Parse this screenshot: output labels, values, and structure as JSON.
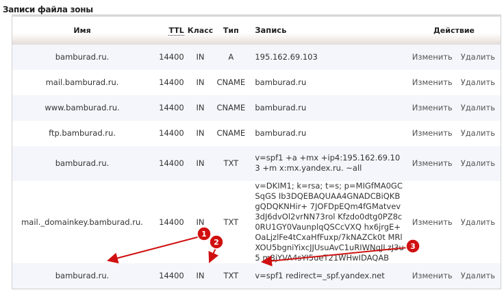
{
  "title": "Записи файла зоны",
  "headers": {
    "name": "Имя",
    "ttl": "TTL",
    "class": "Класс",
    "type": "Тип",
    "record": "Запись",
    "action": "Действие"
  },
  "actions": {
    "edit": "Изменить",
    "delete": "Удалить"
  },
  "rows": [
    {
      "name": "bamburad.ru.",
      "ttl": "14400",
      "class": "IN",
      "type": "A",
      "record": "195.162.69.103"
    },
    {
      "name": "mail.bamburad.ru.",
      "ttl": "14400",
      "class": "IN",
      "type": "CNAME",
      "record": "bamburad.ru"
    },
    {
      "name": "www.bamburad.ru.",
      "ttl": "14400",
      "class": "IN",
      "type": "CNAME",
      "record": "bamburad.ru"
    },
    {
      "name": "ftp.bamburad.ru.",
      "ttl": "14400",
      "class": "IN",
      "type": "CNAME",
      "record": "bamburad.ru"
    },
    {
      "name": "bamburad.ru.",
      "ttl": "14400",
      "class": "IN",
      "type": "TXT",
      "record": "v=spf1 +a +mx +ip4:195.162.69.103 +m x:mx.yandex.ru. ~all"
    },
    {
      "name": "mail._domainkey.bamburad.ru.",
      "ttl": "14400",
      "class": "IN",
      "type": "TXT",
      "record": "v=DKIM1; k=rsa; t=s; p=MIGfMA0GCSqGS Ib3DQEBAQUAA4GNADCBiQKBgQDQKNHir+ 7JOFDpEQm4fGMatvev3dJ6dvOl2vrNN73rol Kfzdo0dtg0PZ8c0RU1GY0VaunplqQSCcVXQ hx6jrgE+OaLjzlFe4tCxaHfFuxp/7kNAZCk0t MRlXOU5bgniYixcJJUsuAvC1uRIWNqJLzJ3u5 m8jYVA4sYI5ueT21WHwIDAQAB"
    },
    {
      "name": "bamburad.ru.",
      "ttl": "14400",
      "class": "IN",
      "type": "TXT",
      "record": "v=spf1 redirect=_spf.yandex.net"
    }
  ],
  "annotations": [
    "1",
    "2",
    "3"
  ],
  "colors": {
    "marker": "#d01010"
  }
}
